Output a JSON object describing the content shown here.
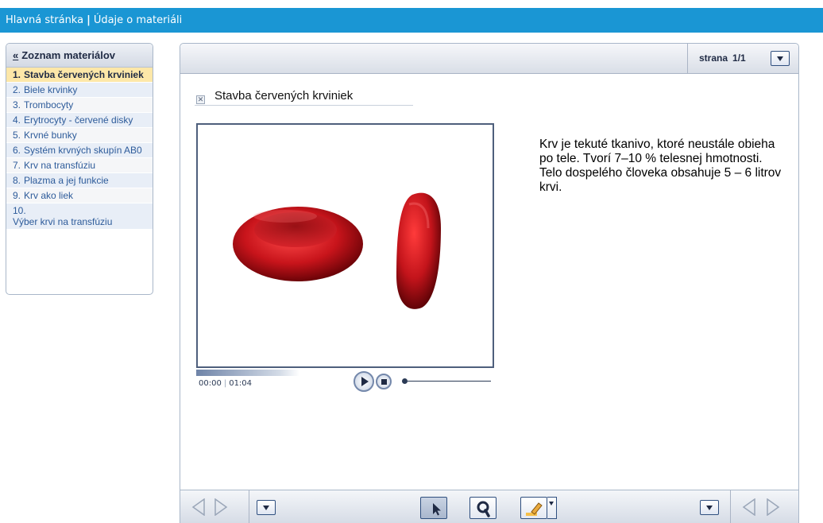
{
  "topbar": {
    "home_link": "Hlavná stránka",
    "separator": "|",
    "details_link": "Údaje o materiáli"
  },
  "sidebar": {
    "back_label": "«",
    "header": "Zoznam materiálov",
    "items": [
      {
        "num": "1.",
        "label": "Stavba červených krviniek"
      },
      {
        "num": "2.",
        "label": "Biele krvinky"
      },
      {
        "num": "3.",
        "label": "Trombocyty"
      },
      {
        "num": "4.",
        "label": "Erytrocyty - červené disky"
      },
      {
        "num": "5.",
        "label": "Krvné bunky"
      },
      {
        "num": "6.",
        "label": "Systém krvných skupín AB0"
      },
      {
        "num": "7.",
        "label": "Krv na transfúziu"
      },
      {
        "num": "8.",
        "label": "Plazma a jej funkcie"
      },
      {
        "num": "9.",
        "label": "Krv ako liek"
      },
      {
        "num": "10.",
        "label": "Výber krvi na transfúziu"
      }
    ]
  },
  "pager": {
    "label": "strana",
    "value": "1/1"
  },
  "content": {
    "title": "Stavba červených krviniek",
    "description_lines": [
      "Krv je tekuté tkanivo, ktoré neustále obieha",
      "po tele. Tvorí 7–10 % telesnej hmotnosti.",
      "Telo dospelého človeka obsahuje 5 – 6 litrov krvi."
    ]
  },
  "player": {
    "current_time": "00:00",
    "total_time": "01:04",
    "progress": 0
  },
  "colors": {
    "topbar": "#1a96d4",
    "active_item": "#fde7a8",
    "cell_red": "#c8141b"
  }
}
